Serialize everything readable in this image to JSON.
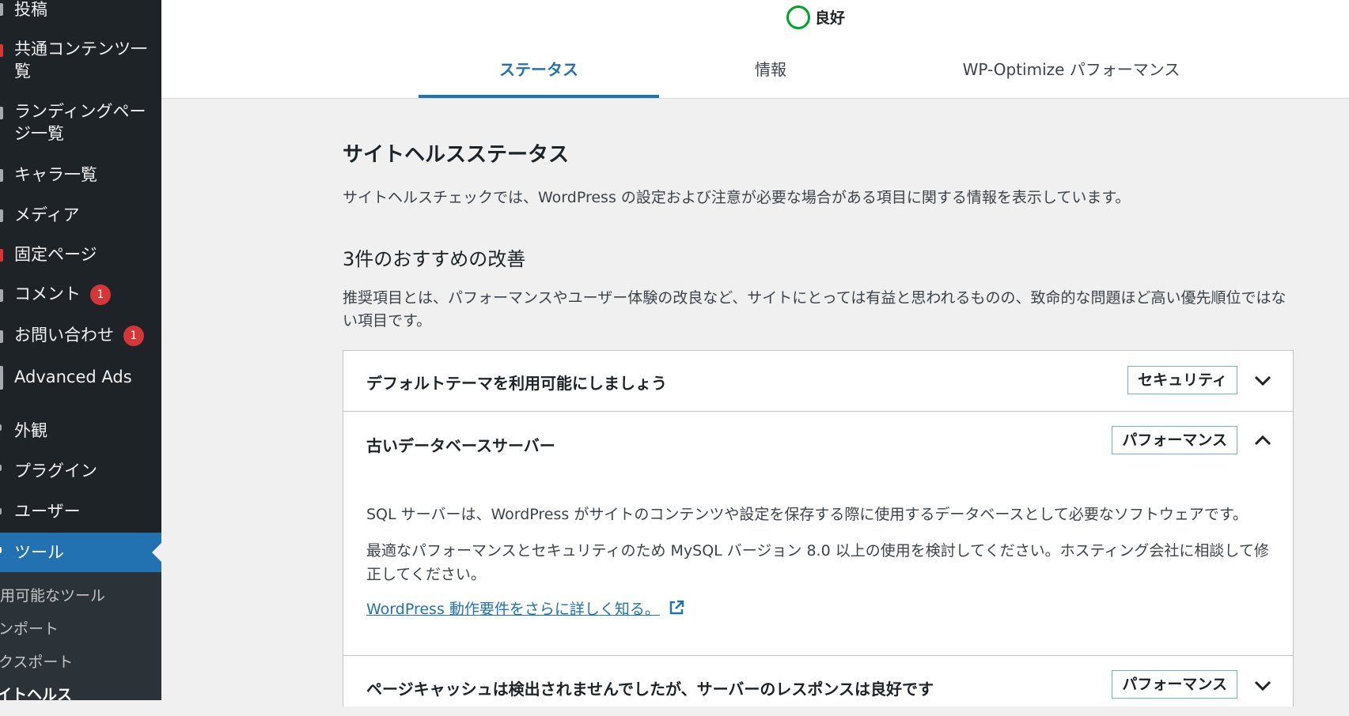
{
  "sidebar": {
    "items": [
      {
        "label": "投稿"
      },
      {
        "label": "共通コンテンツ一覧"
      },
      {
        "label": "ランディングページ一覧"
      },
      {
        "label": "キャラ一覧"
      },
      {
        "label": "メディア"
      },
      {
        "label": "固定ページ"
      },
      {
        "label": "コメント",
        "badge": "1"
      },
      {
        "label": "お問い合わせ",
        "badge": "1"
      },
      {
        "label": "Advanced Ads"
      },
      {
        "label": "外観"
      },
      {
        "label": "プラグイン"
      },
      {
        "label": "ユーザー"
      },
      {
        "label": "ツール"
      }
    ],
    "submenu": [
      {
        "label": "用可能なツール"
      },
      {
        "label": "ンポート"
      },
      {
        "label": "クスポート"
      },
      {
        "label": "イトヘルス"
      }
    ]
  },
  "header": {
    "score_label": "良好",
    "tabs": [
      {
        "label": "ステータス"
      },
      {
        "label": "情報"
      },
      {
        "label": "WP-Optimize パフォーマンス"
      }
    ]
  },
  "main": {
    "title": "サイトヘルスステータス",
    "description": "サイトヘルスチェックでは、WordPress の設定および注意が必要な場合がある項目に関する情報を表示しています。",
    "recommend_heading": "3件のおすすめの改善",
    "recommend_description": "推奨項目とは、パフォーマンスやユーザー体験の改良など、サイトにとっては有益と思われるものの、致命的な問題ほど高い優先順位ではない項目です。",
    "issues": [
      {
        "title": "デフォルトテーマを利用可能にしましょう",
        "badge": "セキュリティ"
      },
      {
        "title": "古いデータベースサーバー",
        "badge": "パフォーマンス",
        "body_1": "SQL サーバーは、WordPress がサイトのコンテンツや設定を保存する際に使用するデータベースとして必要なソフトウェアです。",
        "body_2": "最適なパフォーマンスとセキュリティのため MySQL バージョン 8.0 以上の使用を検討してください。ホスティング会社に相談して修正してください。",
        "link": "WordPress 動作要件をさらに詳しく知る。"
      },
      {
        "title": "ページキャッシュは検出されませんでしたが、サーバーのレスポンスは良好です",
        "badge": "パフォーマンス"
      }
    ]
  },
  "colors": {
    "sidebar_bg": "#1d2327",
    "accent": "#2271b1",
    "good": "#00a32a",
    "badge_red": "#d63638"
  }
}
